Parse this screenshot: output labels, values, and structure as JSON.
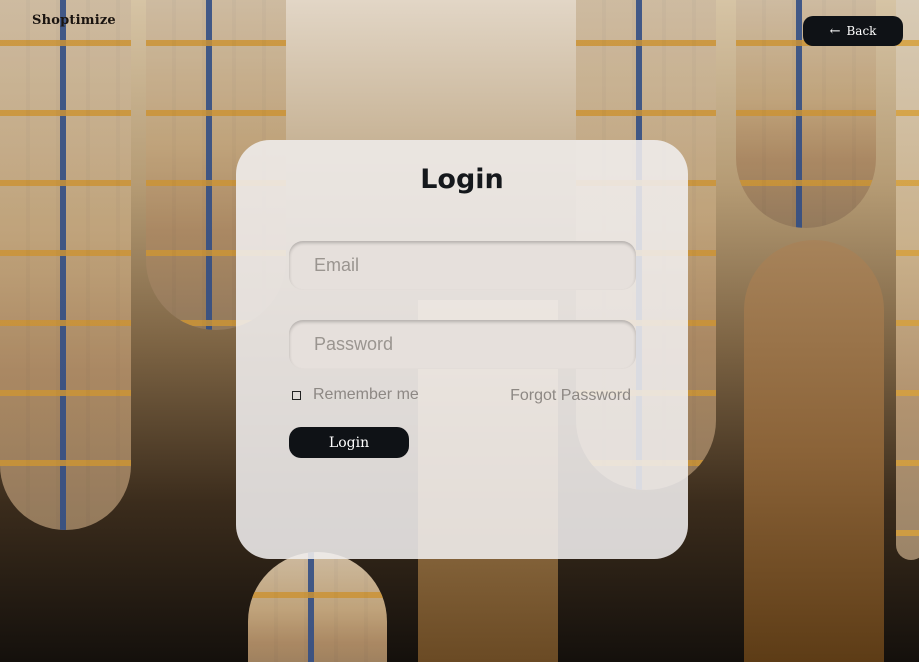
{
  "brand": {
    "name": "Shoptimize"
  },
  "header": {
    "back_label": "Back",
    "back_icon": "arrow-left-icon"
  },
  "login": {
    "title": "Login",
    "email_placeholder": "Email",
    "password_placeholder": "Password",
    "remember_label": "Remember me",
    "remember_checked": false,
    "forgot_label": "Forgot Password",
    "submit_label": "Login"
  },
  "colors": {
    "button_bg": "#0f1216",
    "card_bg": "#f0eeee",
    "field_bg": "#e6e0dc",
    "muted_text": "#8d8884"
  }
}
